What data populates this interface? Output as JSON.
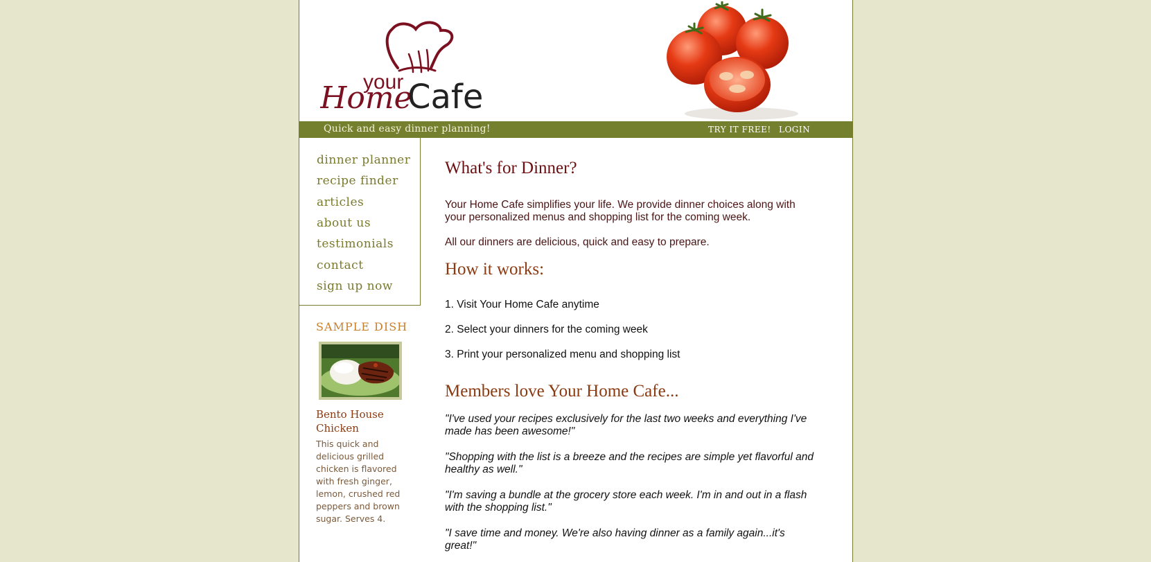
{
  "header": {
    "logo_text": {
      "your": "your",
      "home": "Home",
      "cafe": "Cafe"
    },
    "tagline": "Quick and easy dinner planning!",
    "links": [
      {
        "label": "TRY IT FREE!"
      },
      {
        "label": "LOGIN"
      }
    ]
  },
  "nav": {
    "items": [
      {
        "label": "dinner planner"
      },
      {
        "label": "recipe finder"
      },
      {
        "label": "articles"
      },
      {
        "label": "about us"
      },
      {
        "label": "testimonials"
      },
      {
        "label": "contact"
      },
      {
        "label": "sign up now"
      }
    ]
  },
  "sample_dish": {
    "heading": "SAMPLE DISH",
    "name": "Bento House Chicken",
    "description": "This quick and delicious grilled chicken is flavored with fresh ginger, lemon, crushed red peppers and brown sugar.  Serves 4."
  },
  "main": {
    "intro_title": "What's for Dinner?",
    "intro_paragraphs": [
      "Your Home Cafe simplifies your life.  We provide dinner choices along with your personalized menus and shopping list for the coming week.",
      "All our dinners are delicious, quick and easy to prepare."
    ],
    "how_title": "How it works:",
    "steps": [
      "1. Visit Your Home Cafe anytime",
      "2. Select your dinners for the coming week",
      "3. Print your personalized menu and shopping list"
    ],
    "members_title": "Members love Your Home Cafe...",
    "testimonials": [
      "\"I've used your recipes exclusively for the last two weeks and everything I've made has been awesome!\"",
      "\"Shopping with the list is a breeze and the recipes are simple yet flavorful and healthy as well.\"",
      "\"I'm saving a bundle at the grocery store each week. I'm in and out in a flash with the shopping list.\"",
      "\"I save time and money.  We're also having dinner as a family again...it's great!\""
    ]
  },
  "colors": {
    "page_background": "#e6e6cc",
    "bar_green": "#75802f",
    "nav_olive": "#7a7a2e",
    "title_maroon": "#6b0f12",
    "title_brown": "#8a3a10",
    "sample_orange": "#c97f2a"
  }
}
